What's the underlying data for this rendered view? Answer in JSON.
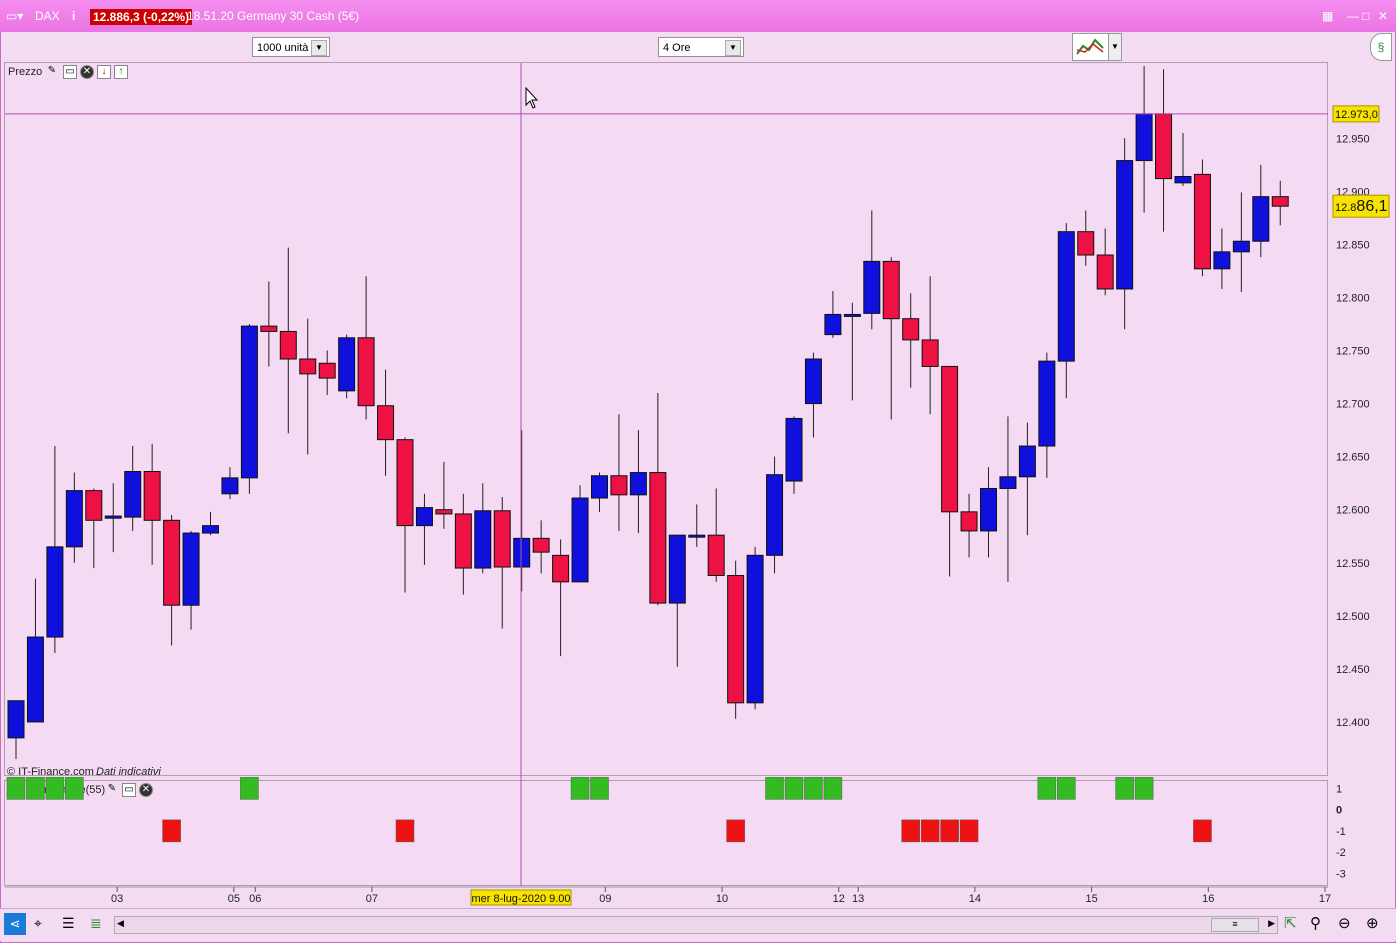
{
  "window": {
    "symbol": "DAX",
    "price_box": "12.886,3 (-0,22%)",
    "time_name": "18.51.20 Germany 30 Cash (5€)",
    "info_icon": "info-icon"
  },
  "toolbar": {
    "quantity": "1000 unità",
    "timeframe": "4 Ore"
  },
  "panels": {
    "price_label": "Prezzo",
    "indicator_label": "Il Mio Indicatore(55)",
    "watermark_source": "© IT-Finance.com",
    "watermark_note": "Dati indicativi"
  },
  "crosshair": {
    "date_label": "mer 8-lug-2020 9.00",
    "price_label": "12.973,0"
  },
  "last_price_label": {
    "small": "12.8",
    "big": "86,1"
  },
  "colors": {
    "up": "#1010dd",
    "down": "#ee1144",
    "ind_up": "#33bb22",
    "ind_down": "#ee1111"
  },
  "chart_data": [
    {
      "type": "candlestick",
      "title": "",
      "ylim": [
        12350,
        13020
      ],
      "y_ticks": [
        12400,
        12450,
        12500,
        12550,
        12600,
        12650,
        12700,
        12750,
        12800,
        12850,
        12900,
        12950
      ],
      "y_tick_labels": [
        "12.400",
        "12.450",
        "12.500",
        "12.550",
        "12.600",
        "12.650",
        "12.700",
        "12.750",
        "12.800",
        "12.850",
        "12.900",
        "12.950"
      ],
      "x_tick_labels": [
        {
          "bar": 5.2,
          "label": "03"
        },
        {
          "bar": 11.2,
          "label": "05"
        },
        {
          "bar": 12.3,
          "label": "06"
        },
        {
          "bar": 18.3,
          "label": "07"
        },
        {
          "bar": 30.3,
          "label": "09"
        },
        {
          "bar": 36.3,
          "label": "10"
        },
        {
          "bar": 42.3,
          "label": "12"
        },
        {
          "bar": 43.3,
          "label": "13"
        },
        {
          "bar": 49.3,
          "label": "14"
        },
        {
          "bar": 55.3,
          "label": "15"
        },
        {
          "bar": 61.3,
          "label": "16"
        },
        {
          "bar": 67.3,
          "label": "17"
        }
      ],
      "candles": [
        {
          "o": 12385,
          "h": 12405,
          "l": 12365,
          "c": 12420
        },
        {
          "o": 12400,
          "h": 12535,
          "l": 12400,
          "c": 12480
        },
        {
          "o": 12480,
          "h": 12660,
          "l": 12465,
          "c": 12565
        },
        {
          "o": 12565,
          "h": 12635,
          "l": 12550,
          "c": 12618
        },
        {
          "o": 12618,
          "h": 12620,
          "l": 12545,
          "c": 12590
        },
        {
          "o": 12592,
          "h": 12625,
          "l": 12560,
          "c": 12594
        },
        {
          "o": 12593,
          "h": 12660,
          "l": 12580,
          "c": 12636
        },
        {
          "o": 12636,
          "h": 12662,
          "l": 12548,
          "c": 12590
        },
        {
          "o": 12590,
          "h": 12595,
          "l": 12472,
          "c": 12510
        },
        {
          "o": 12510,
          "h": 12580,
          "l": 12487,
          "c": 12578
        },
        {
          "o": 12578,
          "h": 12598,
          "l": 12576,
          "c": 12585
        },
        {
          "o": 12615,
          "h": 12640,
          "l": 12610,
          "c": 12630
        },
        {
          "o": 12630,
          "h": 12775,
          "l": 12615,
          "c": 12773
        },
        {
          "o": 12773,
          "h": 12815,
          "l": 12735,
          "c": 12768
        },
        {
          "o": 12768,
          "h": 12847,
          "l": 12672,
          "c": 12742
        },
        {
          "o": 12742,
          "h": 12780,
          "l": 12652,
          "c": 12728
        },
        {
          "o": 12738,
          "h": 12750,
          "l": 12708,
          "c": 12724
        },
        {
          "o": 12712,
          "h": 12765,
          "l": 12705,
          "c": 12762
        },
        {
          "o": 12762,
          "h": 12820,
          "l": 12685,
          "c": 12698
        },
        {
          "o": 12698,
          "h": 12732,
          "l": 12632,
          "c": 12666
        },
        {
          "o": 12666,
          "h": 12668,
          "l": 12522,
          "c": 12585
        },
        {
          "o": 12585,
          "h": 12615,
          "l": 12548,
          "c": 12602
        },
        {
          "o": 12600,
          "h": 12645,
          "l": 12582,
          "c": 12596
        },
        {
          "o": 12596,
          "h": 12615,
          "l": 12520,
          "c": 12545
        },
        {
          "o": 12545,
          "h": 12625,
          "l": 12540,
          "c": 12599
        },
        {
          "o": 12599,
          "h": 12612,
          "l": 12488,
          "c": 12546
        },
        {
          "o": 12546,
          "h": 12675,
          "l": 12523,
          "c": 12573
        },
        {
          "o": 12573,
          "h": 12590,
          "l": 12540,
          "c": 12560
        },
        {
          "o": 12557,
          "h": 12572,
          "l": 12462,
          "c": 12532
        },
        {
          "o": 12532,
          "h": 12623,
          "l": 12533,
          "c": 12611
        },
        {
          "o": 12611,
          "h": 12635,
          "l": 12598,
          "c": 12632
        },
        {
          "o": 12632,
          "h": 12690,
          "l": 12580,
          "c": 12614
        },
        {
          "o": 12614,
          "h": 12675,
          "l": 12578,
          "c": 12635
        },
        {
          "o": 12635,
          "h": 12710,
          "l": 12510,
          "c": 12512
        },
        {
          "o": 12512,
          "h": 12575,
          "l": 12452,
          "c": 12576
        },
        {
          "o": 12576,
          "h": 12605,
          "l": 12565,
          "c": 12576
        },
        {
          "o": 12576,
          "h": 12620,
          "l": 12532,
          "c": 12538
        },
        {
          "o": 12538,
          "h": 12552,
          "l": 12403,
          "c": 12418
        },
        {
          "o": 12418,
          "h": 12565,
          "l": 12412,
          "c": 12557
        },
        {
          "o": 12557,
          "h": 12650,
          "l": 12540,
          "c": 12633
        },
        {
          "o": 12627,
          "h": 12688,
          "l": 12615,
          "c": 12686
        },
        {
          "o": 12700,
          "h": 12748,
          "l": 12668,
          "c": 12742
        },
        {
          "o": 12765,
          "h": 12806,
          "l": 12762,
          "c": 12784
        },
        {
          "o": 12783,
          "h": 12795,
          "l": 12703,
          "c": 12784
        },
        {
          "o": 12785,
          "h": 12882,
          "l": 12770,
          "c": 12834
        },
        {
          "o": 12834,
          "h": 12838,
          "l": 12685,
          "c": 12780
        },
        {
          "o": 12780,
          "h": 12804,
          "l": 12715,
          "c": 12760
        },
        {
          "o": 12760,
          "h": 12820,
          "l": 12690,
          "c": 12735
        },
        {
          "o": 12735,
          "h": 12735,
          "l": 12537,
          "c": 12598
        },
        {
          "o": 12598,
          "h": 12615,
          "l": 12555,
          "c": 12580
        },
        {
          "o": 12580,
          "h": 12640,
          "l": 12555,
          "c": 12620
        },
        {
          "o": 12620,
          "h": 12688,
          "l": 12532,
          "c": 12631
        },
        {
          "o": 12631,
          "h": 12682,
          "l": 12576,
          "c": 12660
        },
        {
          "o": 12660,
          "h": 12748,
          "l": 12630,
          "c": 12740
        },
        {
          "o": 12740,
          "h": 12870,
          "l": 12705,
          "c": 12862
        },
        {
          "o": 12862,
          "h": 12882,
          "l": 12830,
          "c": 12840
        },
        {
          "o": 12840,
          "h": 12865,
          "l": 12802,
          "c": 12808
        },
        {
          "o": 12808,
          "h": 12950,
          "l": 12770,
          "c": 12929
        },
        {
          "o": 12929,
          "h": 13018,
          "l": 12880,
          "c": 12973
        },
        {
          "o": 12973,
          "h": 13015,
          "l": 12862,
          "c": 12912
        },
        {
          "o": 12908,
          "h": 12955,
          "l": 12905,
          "c": 12914
        },
        {
          "o": 12916,
          "h": 12930,
          "l": 12820,
          "c": 12827
        },
        {
          "o": 12827,
          "h": 12865,
          "l": 12808,
          "c": 12843
        },
        {
          "o": 12843,
          "h": 12899,
          "l": 12805,
          "c": 12853
        },
        {
          "o": 12853,
          "h": 12925,
          "l": 12838,
          "c": 12895
        },
        {
          "o": 12895,
          "h": 12910,
          "l": 12868,
          "c": 12886
        }
      ]
    },
    {
      "type": "bar",
      "title": "Il Mio Indicatore(55)",
      "ylim": [
        -3.5,
        1.3
      ],
      "y_ticks": [
        1,
        0,
        -1,
        -2,
        -3
      ],
      "y_tick_labels": [
        "1",
        "0",
        "-1",
        "-2",
        "-3"
      ],
      "bars": [
        {
          "bar": 0,
          "v": 1
        },
        {
          "bar": 1,
          "v": 1
        },
        {
          "bar": 2,
          "v": 1
        },
        {
          "bar": 3,
          "v": 1
        },
        {
          "bar": 8,
          "v": -1
        },
        {
          "bar": 12,
          "v": 1
        },
        {
          "bar": 20,
          "v": -1
        },
        {
          "bar": 29,
          "v": 1
        },
        {
          "bar": 30,
          "v": 1
        },
        {
          "bar": 37,
          "v": -1
        },
        {
          "bar": 39,
          "v": 1
        },
        {
          "bar": 40,
          "v": 1
        },
        {
          "bar": 41,
          "v": 1
        },
        {
          "bar": 42,
          "v": 1
        },
        {
          "bar": 46,
          "v": -1
        },
        {
          "bar": 47,
          "v": -1
        },
        {
          "bar": 48,
          "v": -1
        },
        {
          "bar": 49,
          "v": -1
        },
        {
          "bar": 53,
          "v": 1
        },
        {
          "bar": 54,
          "v": 1
        },
        {
          "bar": 57,
          "v": 1
        },
        {
          "bar": 58,
          "v": 1
        },
        {
          "bar": 61,
          "v": -1
        }
      ]
    }
  ]
}
